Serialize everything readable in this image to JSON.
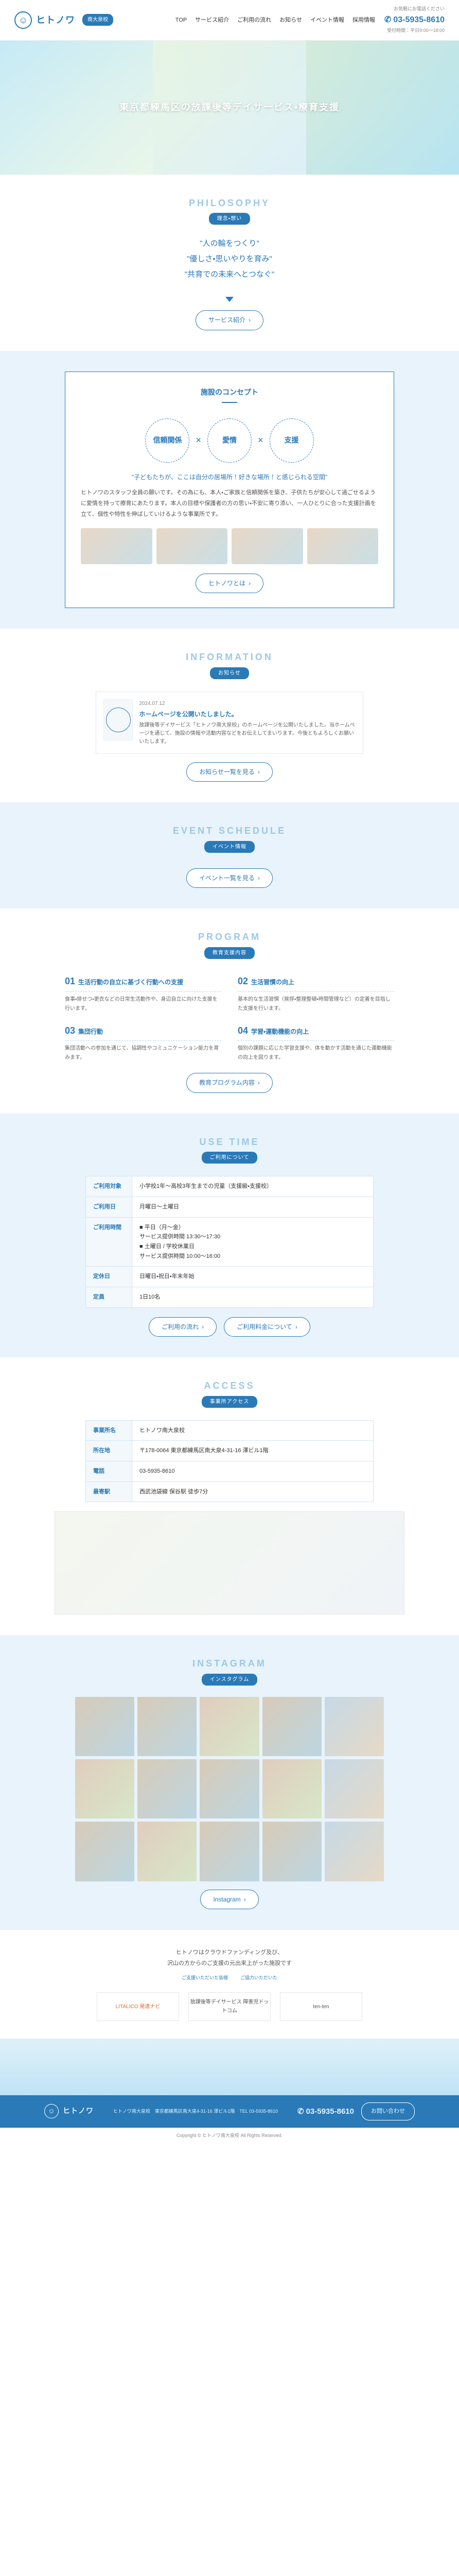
{
  "header": {
    "logo": "ヒトノワ",
    "badge": "南大泉校",
    "nav": [
      "TOP",
      "サービス紹介",
      "ご利用の流れ",
      "お知らせ",
      "イベント情報",
      "採用情報"
    ],
    "tel_label": "お気軽にお電話ください",
    "tel": "03-5935-8610",
    "time": "受付時間：平日9:00〜18:00"
  },
  "hero": {
    "headline": "東京都練馬区の放課後等デイサービス・療育支援"
  },
  "philosophy": {
    "en": "PHILOSOPHY",
    "ja": "理念・想い",
    "lines": [
      "\"人の輪をつくり\"",
      "\"優しさ・思いやりを育み\"",
      "\"共育での未来へとつなぐ\""
    ],
    "btn": "サービス紹介"
  },
  "concept": {
    "title": "施設のコンセプト",
    "circles": [
      "信頼関係",
      "愛情",
      "支援"
    ],
    "lead": "\"子どもたちが、ここは自分の居場所！好きな場所！と感じられる空間\"",
    "body": "ヒトノワのスタッフ全員の願いです。その為にも、本人・ご家族と信頼関係を築き、子供たちが安心して過ごせるように愛情を持って療育にあたります。本人の目標や保護者の方の思い・不安に寄り添い、一人ひとりに合った支援計画を立て、個性や特性を伸ばしていけるような事業所です。",
    "btn": "ヒトノワとは"
  },
  "info": {
    "en": "INFORMATION",
    "ja": "お知らせ",
    "date": "2024.07.12",
    "title": "ホームページを公開いたしました。",
    "desc": "放課後等デイサービス「ヒトノワ南大泉校」のホームページを公開いたしました。当ホームページを通じて、施設の情報や活動内容などをお伝えしてまいります。今後ともよろしくお願いいたします。",
    "btn": "お知らせ一覧を見る"
  },
  "event": {
    "en": "EVENT SCHEDULE",
    "ja": "イベント情報",
    "btn": "イベント一覧を見る"
  },
  "program": {
    "en": "PROGRAM",
    "ja": "教育支援内容",
    "items": [
      {
        "num": "01",
        "ttl": "生活行動の自立に基づく行動への支援",
        "body": "食事・排せつ・更衣などの日常生活動作や、身辺自立に向けた支援を行います。"
      },
      {
        "num": "02",
        "ttl": "生活習慣の向上",
        "body": "基本的な生活習慣（挨拶・整理整頓・時間管理など）の定着を目指した支援を行います。"
      },
      {
        "num": "03",
        "ttl": "集団行動",
        "body": "集団活動への参加を通じて、協調性やコミュニケーション能力を育みます。"
      },
      {
        "num": "04",
        "ttl": "学習・運動機能の向上",
        "body": "個別の課題に応じた学習支援や、体を動かす活動を通じた運動機能の向上を図ります。"
      }
    ],
    "btn": "教育プログラム内容"
  },
  "usetime": {
    "en": "USE TIME",
    "ja": "ご利用について",
    "rows": [
      {
        "th": "ご利用対象",
        "td": "小学校1年〜高校3年生までの児童（支援級・支援校）"
      },
      {
        "th": "ご利用日",
        "td": "月曜日〜土曜日"
      },
      {
        "th": "ご利用時間",
        "td": "■ 平日（月〜金）\nサービス提供時間 13:30〜17:30\n■ 土曜日 / 学校休業日\nサービス提供時間 10:00〜16:00"
      },
      {
        "th": "定休日",
        "td": "日曜日・祝日・年末年始"
      },
      {
        "th": "定員",
        "td": "1日10名"
      }
    ],
    "btn1": "ご利用の流れ",
    "btn2": "ご利用料金について"
  },
  "access": {
    "en": "ACCESS",
    "ja": "事業所アクセス",
    "rows": [
      {
        "th": "事業所名",
        "td": "ヒトノワ南大泉校"
      },
      {
        "th": "所在地",
        "td": "〒178-0064 東京都練馬区南大泉4-31-16 澤ビル1階"
      },
      {
        "th": "電話",
        "td": "03-5935-8610"
      },
      {
        "th": "最寄駅",
        "td": "西武池袋線 保谷駅 徒歩7分"
      }
    ]
  },
  "insta": {
    "en": "INSTAGRAM",
    "ja": "インスタグラム",
    "btn": "Instagram"
  },
  "cf": {
    "copy1": "ヒトノワはクラウドファンディング及び、",
    "copy2": "沢山の方からのご支援の元出来上がった施設です",
    "links": [
      "ご支援いただいた皆様",
      "ご協力いただいた"
    ],
    "b1": "LITALICO 発達ナビ",
    "b2": "放課後等デイサービス 障害児ドットコム",
    "b3": "ten-ten"
  },
  "footer": {
    "logo": "ヒトノワ",
    "addr": "ヒトノワ南大泉校　東京都練馬区南大泉4-31-16 澤ビル1階　TEL 03-5935-8610",
    "tel": "03-5935-8610",
    "btn": "お問い合わせ",
    "copy": "Copyright © ヒトノワ南大泉校 All Rights Reserved."
  }
}
